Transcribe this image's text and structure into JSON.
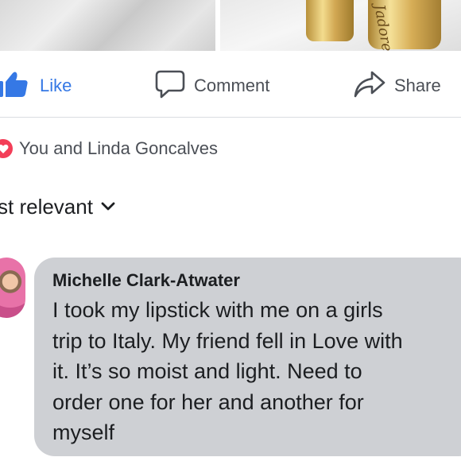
{
  "post_images": [
    {
      "name": "product-photo-left"
    },
    {
      "name": "product-photo-right",
      "engraving": "Jadore la"
    }
  ],
  "actions": {
    "like_label": "Like",
    "comment_label": "Comment",
    "share_label": "Share",
    "like_color": "#3578e5",
    "like_icon": "thumbs-up-icon",
    "comment_icon": "comment-bubble-icon",
    "share_icon": "share-arrow-icon"
  },
  "reactions": {
    "icon": "heart-icon",
    "color": "#f33e58",
    "summary": "You and Linda Goncalves"
  },
  "sort": {
    "label": "st relevant",
    "icon": "chevron-down-icon"
  },
  "comment": {
    "author": "Michelle Clark-Atwater",
    "lines": [
      "I took my lipstick with me on a girls",
      "trip to Italy. My friend fell in Love with",
      "it. It’s so moist and light. Need to",
      "order one for her and another for",
      "myself"
    ],
    "bubble_color": "#ced0d4"
  }
}
